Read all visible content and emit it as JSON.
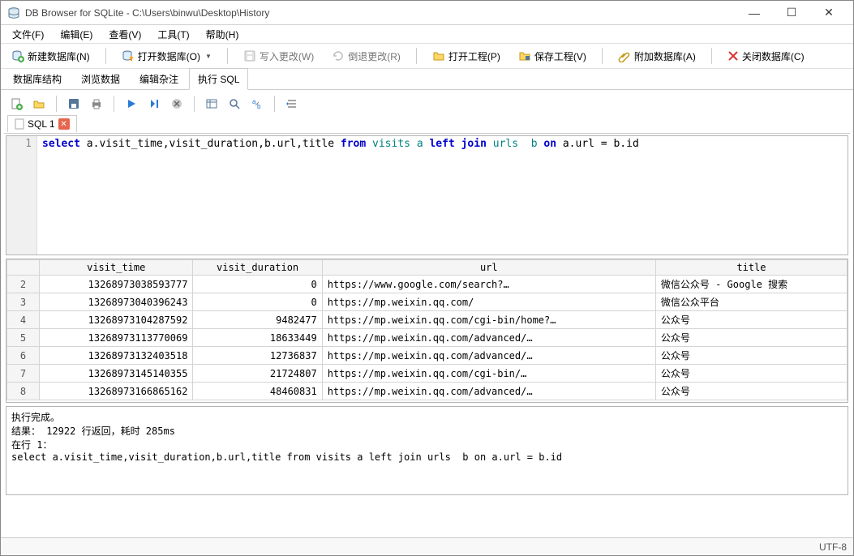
{
  "window": {
    "title": "DB Browser for SQLite - C:\\Users\\binwu\\Desktop\\History"
  },
  "menu": {
    "file": "文件(F)",
    "edit": "编辑(E)",
    "view": "查看(V)",
    "tools": "工具(T)",
    "help": "帮助(H)"
  },
  "toolbar": {
    "new_db": "新建数据库(N)",
    "open_db": "打开数据库(O)",
    "write_changes": "写入更改(W)",
    "revert_changes": "倒退更改(R)",
    "open_project": "打开工程(P)",
    "save_project": "保存工程(V)",
    "attach_db": "附加数据库(A)",
    "close_db": "关闭数据库(C)"
  },
  "tabs": {
    "structure": "数据库结构",
    "browse": "浏览数据",
    "pragmas": "编辑杂注",
    "sql": "执行 SQL"
  },
  "sql_tab": {
    "label": "SQL 1"
  },
  "editor": {
    "line_no": "1"
  },
  "sql_tokens": {
    "select": "select",
    "fields": "a.visit_time,visit_duration,b.url,title",
    "from": "from",
    "t1": "visits",
    "a": "a",
    "left": "left",
    "join": "join",
    "t2": "urls",
    "b": "b",
    "on": "on",
    "cond": "a.url = b.id"
  },
  "columns": [
    "",
    "visit_time",
    "visit_duration",
    "url",
    "title"
  ],
  "rows": [
    {
      "n": "2",
      "vt": "13268973038593777",
      "vd": "0",
      "url": "https://www.google.com/search?…",
      "title": "微信公众号 - Google 搜索"
    },
    {
      "n": "3",
      "vt": "13268973040396243",
      "vd": "0",
      "url": "https://mp.weixin.qq.com/",
      "title": "微信公众平台"
    },
    {
      "n": "4",
      "vt": "13268973104287592",
      "vd": "9482477",
      "url": "https://mp.weixin.qq.com/cgi-bin/home?…",
      "title": "公众号"
    },
    {
      "n": "5",
      "vt": "13268973113770069",
      "vd": "18633449",
      "url": "https://mp.weixin.qq.com/advanced/…",
      "title": "公众号"
    },
    {
      "n": "6",
      "vt": "13268973132403518",
      "vd": "12736837",
      "url": "https://mp.weixin.qq.com/advanced/…",
      "title": "公众号"
    },
    {
      "n": "7",
      "vt": "13268973145140355",
      "vd": "21724807",
      "url": "https://mp.weixin.qq.com/cgi-bin/…",
      "title": "公众号"
    },
    {
      "n": "8",
      "vt": "13268973166865162",
      "vd": "48460831",
      "url": "https://mp.weixin.qq.com/advanced/…",
      "title": "公众号"
    }
  ],
  "log": {
    "l1": "执行完成。",
    "l2": "结果： 12922 行返回，耗时 285ms",
    "l3": "在行 1：",
    "l4": "select a.visit_time,visit_duration,b.url,title from visits a left join urls  b on a.url = b.id"
  },
  "status": {
    "encoding": "UTF-8"
  }
}
